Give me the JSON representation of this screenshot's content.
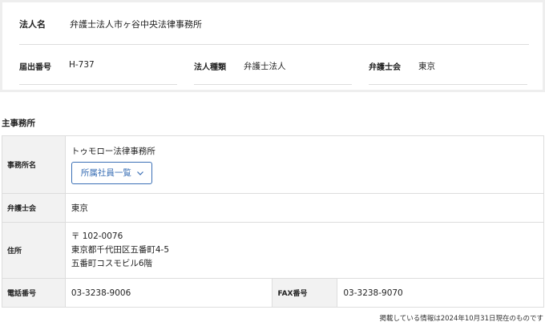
{
  "corporation": {
    "name_label": "法人名",
    "name_value": "弁護士法人市ヶ谷中央法律事務所",
    "reg_label": "届出番号",
    "reg_value": "H-737",
    "type_label": "法人種類",
    "type_value": "弁護士法人",
    "bar_label": "弁護士会",
    "bar_value": "東京"
  },
  "main_office": {
    "section_title": "主事務所",
    "office_name_label": "事務所名",
    "office_name_value": "トゥモロー法律事務所",
    "members_button": "所属社員一覧",
    "bar_label": "弁護士会",
    "bar_value": "東京",
    "address_label": "住所",
    "address_lines": [
      "〒 102-0076",
      "東京都千代田区五番町4-5",
      "五番町コスモビル6階"
    ],
    "phone_label": "電話番号",
    "phone_value": "03-3238-9006",
    "fax_label": "FAX番号",
    "fax_value": "03-3238-9070"
  },
  "footnote": "掲載している情報は2024年10月31日現在のものです"
}
